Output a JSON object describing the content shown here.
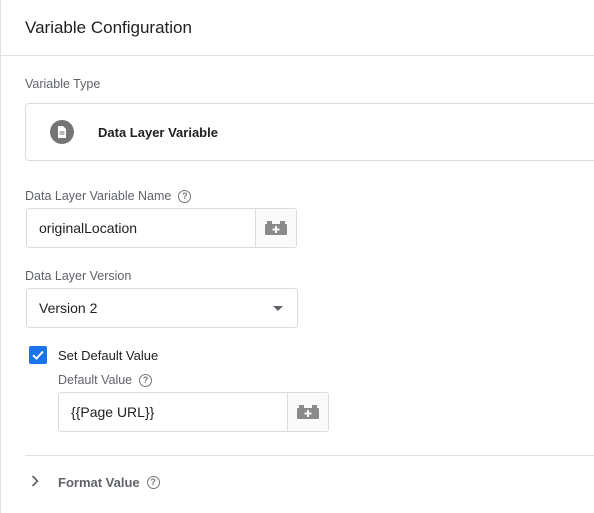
{
  "header": {
    "title": "Variable Configuration"
  },
  "variable_type": {
    "label": "Variable Type",
    "icon": "document-icon",
    "value": "Data Layer Variable"
  },
  "dlv_name": {
    "label": "Data Layer Variable Name",
    "help": "?",
    "value": "originalLocation",
    "var_button_icon": "variable-brick-icon"
  },
  "dlv_version": {
    "label": "Data Layer Version",
    "selected": "Version 2"
  },
  "default_value": {
    "checkbox_label": "Set Default Value",
    "checked": true,
    "label": "Default Value",
    "help": "?",
    "value": "{{Page URL}}",
    "var_button_icon": "variable-brick-icon"
  },
  "format_value": {
    "label": "Format Value",
    "help": "?",
    "expanded": false
  },
  "colors": {
    "accent": "#1a73e8",
    "border": "#dadce0",
    "icon_grey": "#757575"
  }
}
